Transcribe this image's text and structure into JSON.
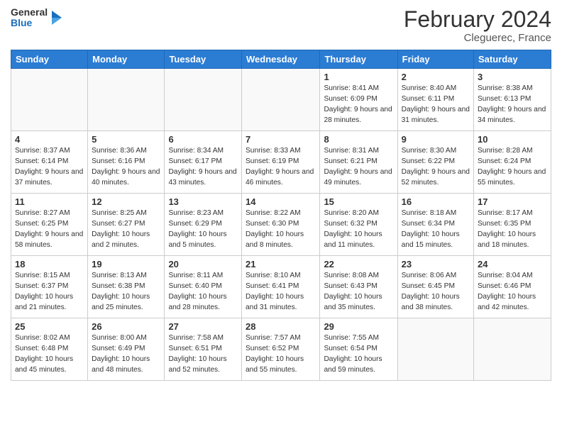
{
  "header": {
    "logo_line1": "General",
    "logo_line2": "Blue",
    "title": "February 2024",
    "subtitle": "Cleguerec, France"
  },
  "days_of_week": [
    "Sunday",
    "Monday",
    "Tuesday",
    "Wednesday",
    "Thursday",
    "Friday",
    "Saturday"
  ],
  "weeks": [
    [
      {
        "day": "",
        "info": ""
      },
      {
        "day": "",
        "info": ""
      },
      {
        "day": "",
        "info": ""
      },
      {
        "day": "",
        "info": ""
      },
      {
        "day": "1",
        "info": "Sunrise: 8:41 AM\nSunset: 6:09 PM\nDaylight: 9 hours and 28 minutes."
      },
      {
        "day": "2",
        "info": "Sunrise: 8:40 AM\nSunset: 6:11 PM\nDaylight: 9 hours and 31 minutes."
      },
      {
        "day": "3",
        "info": "Sunrise: 8:38 AM\nSunset: 6:13 PM\nDaylight: 9 hours and 34 minutes."
      }
    ],
    [
      {
        "day": "4",
        "info": "Sunrise: 8:37 AM\nSunset: 6:14 PM\nDaylight: 9 hours and 37 minutes."
      },
      {
        "day": "5",
        "info": "Sunrise: 8:36 AM\nSunset: 6:16 PM\nDaylight: 9 hours and 40 minutes."
      },
      {
        "day": "6",
        "info": "Sunrise: 8:34 AM\nSunset: 6:17 PM\nDaylight: 9 hours and 43 minutes."
      },
      {
        "day": "7",
        "info": "Sunrise: 8:33 AM\nSunset: 6:19 PM\nDaylight: 9 hours and 46 minutes."
      },
      {
        "day": "8",
        "info": "Sunrise: 8:31 AM\nSunset: 6:21 PM\nDaylight: 9 hours and 49 minutes."
      },
      {
        "day": "9",
        "info": "Sunrise: 8:30 AM\nSunset: 6:22 PM\nDaylight: 9 hours and 52 minutes."
      },
      {
        "day": "10",
        "info": "Sunrise: 8:28 AM\nSunset: 6:24 PM\nDaylight: 9 hours and 55 minutes."
      }
    ],
    [
      {
        "day": "11",
        "info": "Sunrise: 8:27 AM\nSunset: 6:25 PM\nDaylight: 9 hours and 58 minutes."
      },
      {
        "day": "12",
        "info": "Sunrise: 8:25 AM\nSunset: 6:27 PM\nDaylight: 10 hours and 2 minutes."
      },
      {
        "day": "13",
        "info": "Sunrise: 8:23 AM\nSunset: 6:29 PM\nDaylight: 10 hours and 5 minutes."
      },
      {
        "day": "14",
        "info": "Sunrise: 8:22 AM\nSunset: 6:30 PM\nDaylight: 10 hours and 8 minutes."
      },
      {
        "day": "15",
        "info": "Sunrise: 8:20 AM\nSunset: 6:32 PM\nDaylight: 10 hours and 11 minutes."
      },
      {
        "day": "16",
        "info": "Sunrise: 8:18 AM\nSunset: 6:34 PM\nDaylight: 10 hours and 15 minutes."
      },
      {
        "day": "17",
        "info": "Sunrise: 8:17 AM\nSunset: 6:35 PM\nDaylight: 10 hours and 18 minutes."
      }
    ],
    [
      {
        "day": "18",
        "info": "Sunrise: 8:15 AM\nSunset: 6:37 PM\nDaylight: 10 hours and 21 minutes."
      },
      {
        "day": "19",
        "info": "Sunrise: 8:13 AM\nSunset: 6:38 PM\nDaylight: 10 hours and 25 minutes."
      },
      {
        "day": "20",
        "info": "Sunrise: 8:11 AM\nSunset: 6:40 PM\nDaylight: 10 hours and 28 minutes."
      },
      {
        "day": "21",
        "info": "Sunrise: 8:10 AM\nSunset: 6:41 PM\nDaylight: 10 hours and 31 minutes."
      },
      {
        "day": "22",
        "info": "Sunrise: 8:08 AM\nSunset: 6:43 PM\nDaylight: 10 hours and 35 minutes."
      },
      {
        "day": "23",
        "info": "Sunrise: 8:06 AM\nSunset: 6:45 PM\nDaylight: 10 hours and 38 minutes."
      },
      {
        "day": "24",
        "info": "Sunrise: 8:04 AM\nSunset: 6:46 PM\nDaylight: 10 hours and 42 minutes."
      }
    ],
    [
      {
        "day": "25",
        "info": "Sunrise: 8:02 AM\nSunset: 6:48 PM\nDaylight: 10 hours and 45 minutes."
      },
      {
        "day": "26",
        "info": "Sunrise: 8:00 AM\nSunset: 6:49 PM\nDaylight: 10 hours and 48 minutes."
      },
      {
        "day": "27",
        "info": "Sunrise: 7:58 AM\nSunset: 6:51 PM\nDaylight: 10 hours and 52 minutes."
      },
      {
        "day": "28",
        "info": "Sunrise: 7:57 AM\nSunset: 6:52 PM\nDaylight: 10 hours and 55 minutes."
      },
      {
        "day": "29",
        "info": "Sunrise: 7:55 AM\nSunset: 6:54 PM\nDaylight: 10 hours and 59 minutes."
      },
      {
        "day": "",
        "info": ""
      },
      {
        "day": "",
        "info": ""
      }
    ]
  ]
}
